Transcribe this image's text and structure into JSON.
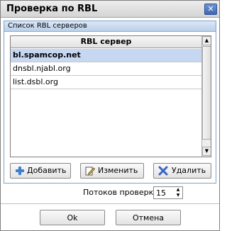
{
  "window": {
    "title": "Проверка по RBL",
    "close_symbol": "✕"
  },
  "panel": {
    "title": "Список RBL серверов"
  },
  "list": {
    "column_header": "RBL сервер",
    "rows": [
      "bl.spamcop.net",
      "dnsbl.njabl.org",
      "list.dsbl.org"
    ],
    "selected_index": 0
  },
  "scrollbar": {
    "up_symbol": "▲",
    "down_symbol": "▼"
  },
  "actions": {
    "add_label": "Добавить",
    "edit_label": "Изменить",
    "delete_label": "Удалить"
  },
  "threads": {
    "label": "Потоков проверки:",
    "value": "15",
    "up_symbol": "▲",
    "down_symbol": "▼"
  },
  "dialog": {
    "ok_label": "Ok",
    "cancel_label": "Отмена"
  },
  "colors": {
    "accent": "#3e67b4",
    "selection": "#c6d7f1",
    "panel_header": "#dce8f6",
    "add_icon": "#3d7fd1",
    "delete_icon": "#3a63c4"
  },
  "icons": {
    "add": "plus-icon",
    "edit": "pencil-icon",
    "delete": "cross-icon",
    "close": "close-icon"
  }
}
